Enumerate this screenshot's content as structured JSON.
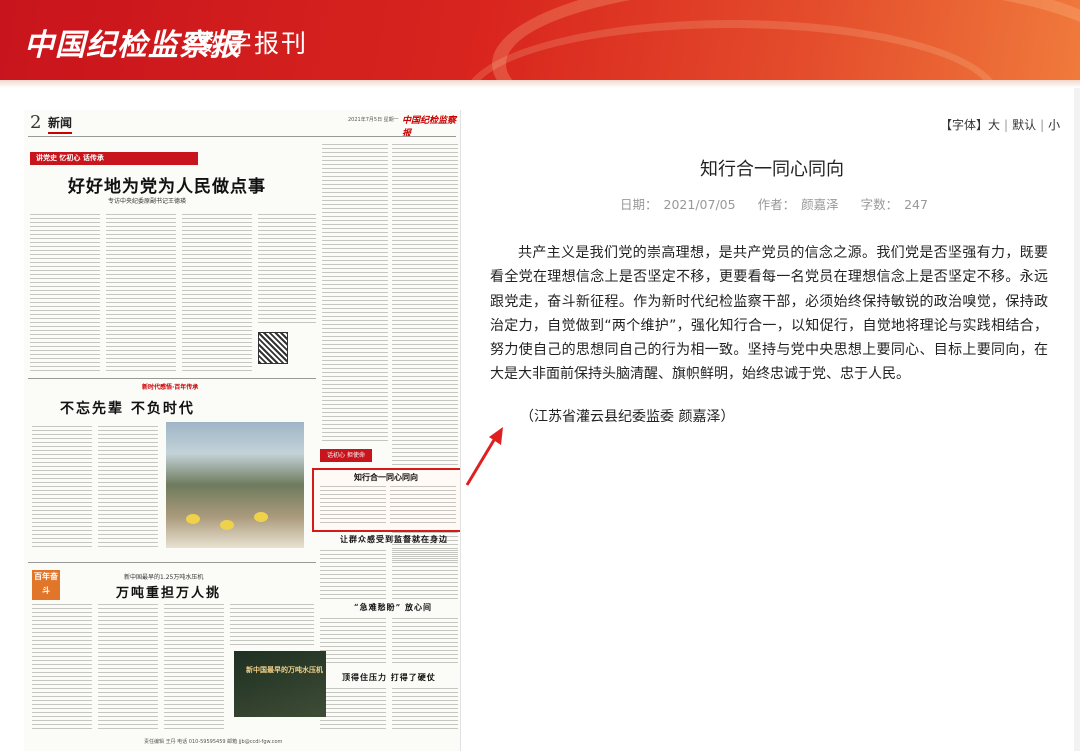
{
  "header": {
    "logo_text": "中国纪检监察报",
    "subtitle": "数字报刊",
    "brand_color": "#d9251e"
  },
  "newspaper_page": {
    "page_number": "2",
    "section": "新闻",
    "date_line": "2021年7月5日  星期一",
    "paper_name": "中国纪检监察报",
    "banner": "讲党史 忆初心 话传承",
    "main_headline": "好好地为党为人民做点事",
    "main_subhead": "专访中央纪委原副书记王德瑛",
    "section_tag": "新时代感悟·百年传承",
    "story2_headline": "不忘先辈 不负时代",
    "highlight_tag": "话初心 担使命",
    "highlight_headline": "知行合一同心同向",
    "right_headline_1": "让群众感受到监督就在身边",
    "right_headline_2": "“急难愁盼” 放心间",
    "right_headline_3": "顶得住压力 打得了硬仗",
    "badge": "百年奋斗",
    "story3_kicker": "新中国最早的1.25万吨水压机",
    "story3_headline": "万吨重担万人挑",
    "photo2_caption": "新中国最早的万吨水压机",
    "footer": "责任编辑 王丹  电话 010-59595459  邮箱 jjb@ccdi-fgw.com"
  },
  "toolbar": {
    "font_label": "【字体】",
    "large": "大",
    "default": "默认",
    "small": "小"
  },
  "article": {
    "title": "知行合一同心同向",
    "date_label": "日期：",
    "date": "2021/07/05",
    "author_label": "作者：",
    "author": "颜嘉泽",
    "wordcount_label": "字数：",
    "wordcount": "247",
    "body": "共产主义是我们党的崇高理想，是共产党员的信念之源。我们党是否坚强有力，既要看全党在理想信念上是否坚定不移，更要看每一名党员在理想信念上是否坚定不移。永远跟党走，奋斗新征程。作为新时代纪检监察干部，必须始终保持敏锐的政治嗅觉，保持政治定力，自觉做到“两个维护”，强化知行合一，以知促行，自觉地将理论与实践相结合，努力使自己的思想同自己的行为相一致。坚持与党中央思想上要同心、目标上要同向，在大是大非面前保持头脑清醒、旗帜鲜明，始终忠诚于党、忠于人民。",
    "byline": "（江苏省灌云县纪委监委 颜嘉泽）"
  }
}
